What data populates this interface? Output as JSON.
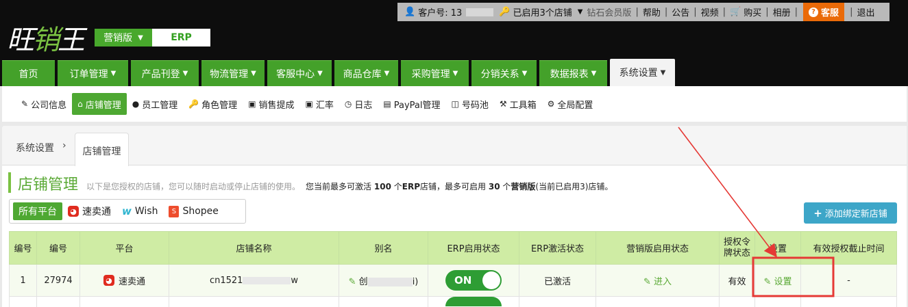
{
  "topbar": {
    "customer_label": "客户号: 13",
    "stores_label": "已启用3个店铺",
    "member_label": "钻石会员版",
    "links": [
      "帮助",
      "公告",
      "视频",
      "购买",
      "相册"
    ],
    "kefu": "客服",
    "logout": "退出"
  },
  "brand": {
    "logo_a": "旺",
    "logo_b": "销",
    "logo_c": "王",
    "edition": "营销版",
    "erp": "ERP"
  },
  "nav": {
    "items": [
      {
        "label": "首页",
        "dropdown": false
      },
      {
        "label": "订单管理",
        "dropdown": true
      },
      {
        "label": "产品刊登",
        "dropdown": true
      },
      {
        "label": "物流管理",
        "dropdown": true
      },
      {
        "label": "客服中心",
        "dropdown": true
      },
      {
        "label": "商品仓库",
        "dropdown": true
      },
      {
        "label": "采购管理",
        "dropdown": true
      },
      {
        "label": "分销关系",
        "dropdown": true
      },
      {
        "label": "数据报表",
        "dropdown": true
      },
      {
        "label": "系统设置",
        "dropdown": true,
        "active": true
      }
    ]
  },
  "subnav": {
    "items": [
      "公司信息",
      "店铺管理",
      "员工管理",
      "角色管理",
      "销售提成",
      "汇率",
      "日志",
      "PayPal管理",
      "号码池",
      "工具箱",
      "全局配置"
    ]
  },
  "breadcrumb": {
    "root": "系统设置",
    "arrow": "›",
    "current": "店铺管理"
  },
  "page": {
    "title": "店铺管理",
    "desc": "以下是您授权的店铺，您可以随时启动或停止店铺的使用。",
    "limit_a": "您当前最多可激活",
    "erp_count": "100",
    "limit_b": "个",
    "erp_word": "ERP",
    "limit_c": "店铺，最多可启用",
    "mkt_count": "30",
    "limit_d": "个",
    "mkt_word": "营销版",
    "limit_e": "(当前已启用3)店铺。"
  },
  "filter": {
    "all": "所有平台",
    "aliexpress": "速卖通",
    "wish": "Wish",
    "shopee": "Shopee"
  },
  "add_button": "添加绑定新店铺",
  "table": {
    "headers": [
      "编号",
      "编号",
      "平台",
      "店铺名称",
      "别名",
      "ERP启用状态",
      "ERP激活状态",
      "营销版启用状态",
      "授权令牌状态",
      "设置",
      "有效授权截止时间"
    ],
    "rows": [
      {
        "index": "1",
        "id": "27974",
        "platform": "速卖通",
        "store_name_prefix": "cn1521",
        "store_name_suffix": "w",
        "alias_prefix": "创",
        "alias_suffix": "i)",
        "erp_toggle": "ON",
        "erp_activation": "已激活",
        "marketing": "进入",
        "token": "有效",
        "settings": "设置",
        "expiry": "-"
      }
    ]
  },
  "colors": {
    "header_bg": "#0d0d0d",
    "nav_green": "#44a12a",
    "accent_green": "#4ea832",
    "title_green": "#5aa935",
    "table_header": "#cfeca4",
    "kefu_orange": "#ea6a08",
    "add_button_blue": "#3da6c8",
    "annotation_red": "#e53935"
  }
}
